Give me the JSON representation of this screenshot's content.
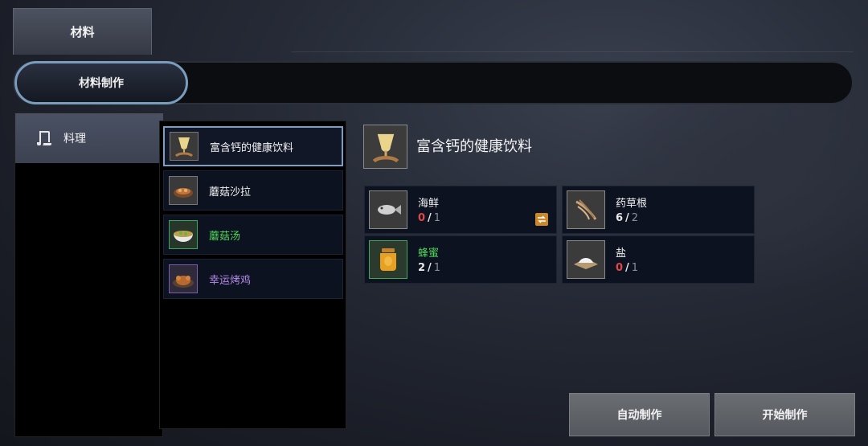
{
  "top_tab": {
    "label": "材料"
  },
  "category_bar": {
    "active": "材料制作"
  },
  "left_panel": {
    "items": [
      {
        "label": "料理",
        "icon": "scroll-icon"
      }
    ]
  },
  "recipes": [
    {
      "name": "富含钙的健康饮料",
      "rarity": "white",
      "icon": "drink-icon",
      "selected": true
    },
    {
      "name": "蘑菇沙拉",
      "rarity": "white",
      "icon": "salad-icon",
      "selected": false
    },
    {
      "name": "蘑菇汤",
      "rarity": "green",
      "icon": "soup-icon",
      "selected": false
    },
    {
      "name": "幸运烤鸡",
      "rarity": "purple",
      "icon": "roast-chicken-icon",
      "selected": false
    }
  ],
  "detail": {
    "title": "富含钙的健康饮料",
    "icon": "drink-icon",
    "ingredients": [
      {
        "name": "海鲜",
        "have": "0",
        "need": "1",
        "name_color": "white",
        "have_color": "red",
        "icon": "fish-icon",
        "badge": "transfer-icon"
      },
      {
        "name": "药草根",
        "have": "6",
        "need": "2",
        "name_color": "white",
        "have_color": "white",
        "icon": "herb-root-icon"
      },
      {
        "name": "蜂蜜",
        "have": "2",
        "need": "1",
        "name_color": "green",
        "have_color": "white",
        "icon": "honey-jar-icon"
      },
      {
        "name": "盐",
        "have": "0",
        "need": "1",
        "name_color": "white",
        "have_color": "red",
        "icon": "salt-icon"
      }
    ]
  },
  "buttons": {
    "auto_craft": "自动制作",
    "start_craft": "开始制作"
  },
  "colors": {
    "accent_border": "#7a9ec4",
    "green_rarity": "#4fd65a",
    "purple_rarity": "#b48be8",
    "missing_red": "#e04848"
  }
}
